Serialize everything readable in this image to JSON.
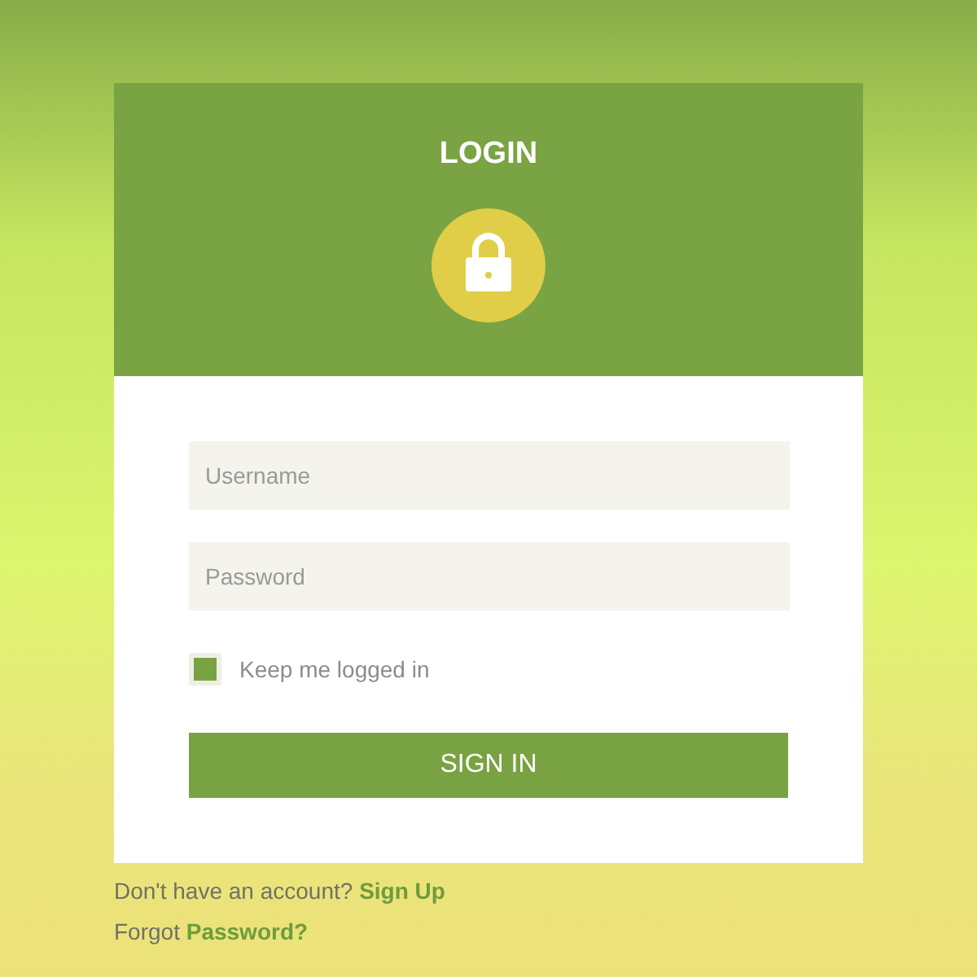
{
  "title": "LOGIN",
  "fields": [
    {
      "placeholder": "Username"
    },
    {
      "placeholder": "Password"
    }
  ],
  "remember": {
    "label": "Keep me logged in",
    "checked": true
  },
  "submit": "SIGN IN",
  "footer_links": [
    {
      "text": "Don't have an account?",
      "link": "Sign Up"
    },
    {
      "text": "Forgot",
      "link": "Password?"
    }
  ]
}
